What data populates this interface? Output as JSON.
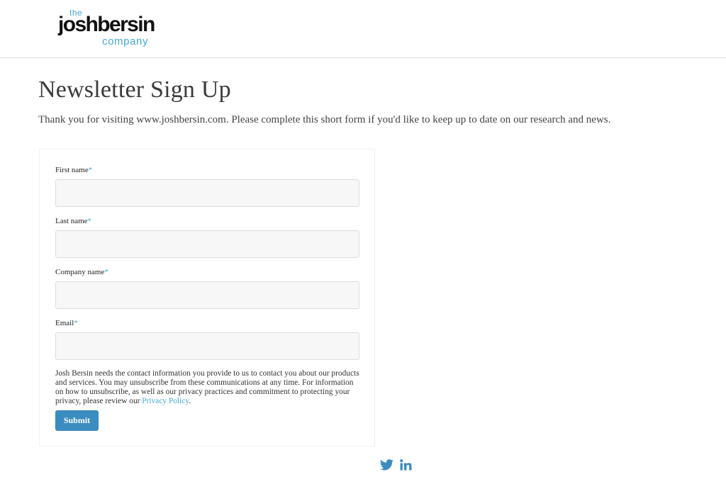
{
  "header": {
    "logo": {
      "the": "the",
      "main": "joshbersin",
      "company": "company"
    }
  },
  "page": {
    "title": "Newsletter Sign Up",
    "intro": "Thank you for visiting www.joshbersin.com. Please complete this short form if you'd like to keep up to date on our research and news."
  },
  "form": {
    "required_mark": "*",
    "fields": [
      {
        "label": "First name",
        "value": "",
        "placeholder": ""
      },
      {
        "label": "Last name",
        "value": "",
        "placeholder": ""
      },
      {
        "label": "Company name",
        "value": "",
        "placeholder": ""
      },
      {
        "label": "Email",
        "value": "",
        "placeholder": ""
      }
    ],
    "legal_text": "Josh Bersin needs the contact information you provide to us to contact you about our products and services. You may unsubscribe from these communications at any time. For information on how to unsubscribe, as well as our privacy practices and commitment to protecting your privacy, please review our ",
    "privacy_link": "Privacy Policy",
    "legal_end": ".",
    "submit_label": "Submit"
  },
  "footer": {
    "social": [
      {
        "icon": "twitter-icon"
      },
      {
        "icon": "linkedin-icon"
      }
    ]
  },
  "colors": {
    "accent": "#45a8dc",
    "button": "#3b8cc1",
    "input_bg": "#f7f7f7"
  }
}
